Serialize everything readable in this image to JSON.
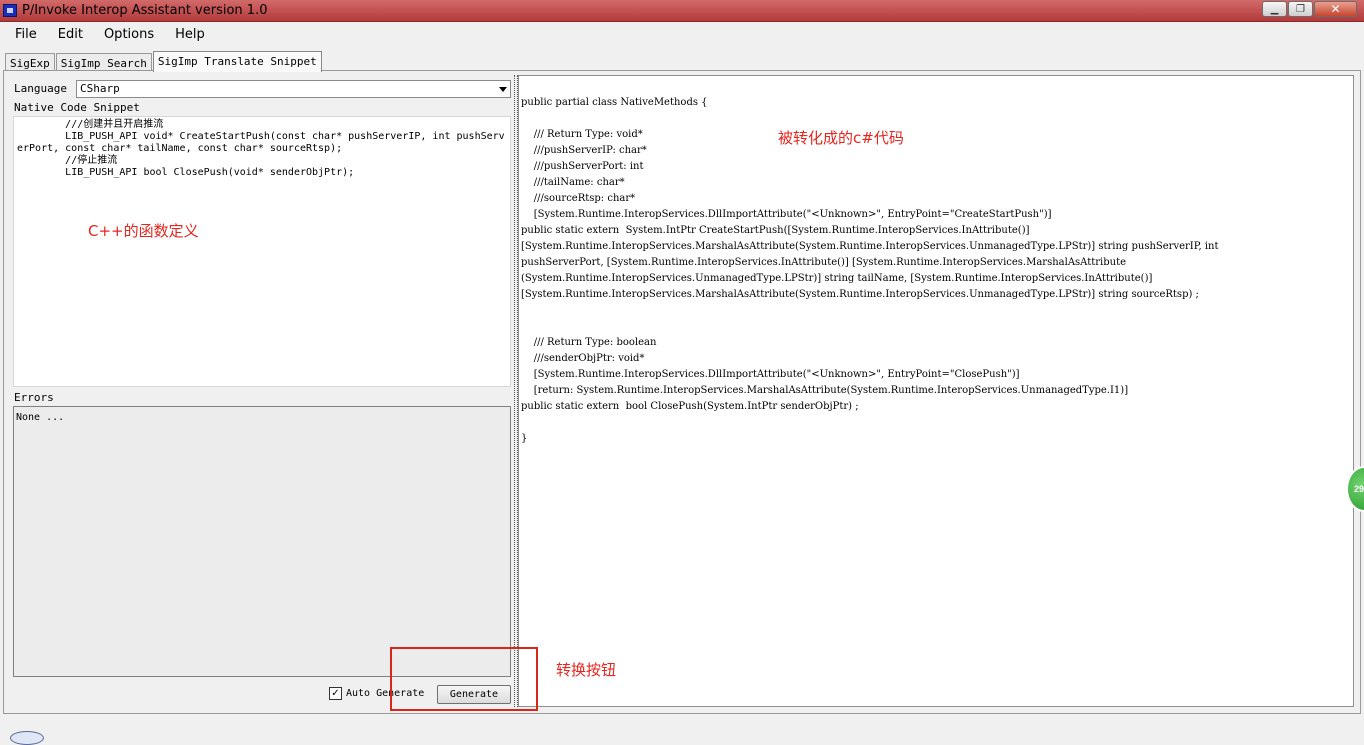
{
  "window": {
    "title": "P/Invoke Interop Assistant version 1.0",
    "min_glyph": "▁",
    "max_glyph": "❐",
    "close_glyph": "✕"
  },
  "menu": [
    "File",
    "Edit",
    "Options",
    "Help"
  ],
  "tabs": [
    "SigExp",
    "SigImp Search",
    "SigImp Translate Snippet"
  ],
  "active_tab": 2,
  "left": {
    "language_label": "Language",
    "language_value": "CSharp",
    "native_label": "Native Code Snippet",
    "native_code": "        ///创建并且开启推流\n        LIB_PUSH_API void* CreateStartPush(const char* pushServerIP, int pushServerPort, const char* tailName, const char* sourceRtsp);\n        //停止推流\n        LIB_PUSH_API bool ClosePush(void* senderObjPtr);",
    "errors_label": "Errors",
    "errors_text": "None ...",
    "auto_generate_label": "Auto Generate",
    "auto_generate_checked": "✓",
    "generate_label": "Generate"
  },
  "right": {
    "code": "public partial class NativeMethods {\n\n    /// Return Type: void*\n    ///pushServerIP: char*\n    ///pushServerPort: int\n    ///tailName: char*\n    ///sourceRtsp: char*\n    [System.Runtime.InteropServices.DllImportAttribute(\"<Unknown>\", EntryPoint=\"CreateStartPush\")]\npublic static extern  System.IntPtr CreateStartPush([System.Runtime.InteropServices.InAttribute()]\n[System.Runtime.InteropServices.MarshalAsAttribute(System.Runtime.InteropServices.UnmanagedType.LPStr)] string pushServerIP, int\npushServerPort, [System.Runtime.InteropServices.InAttribute()] [System.Runtime.InteropServices.MarshalAsAttribute\n(System.Runtime.InteropServices.UnmanagedType.LPStr)] string tailName, [System.Runtime.InteropServices.InAttribute()]\n[System.Runtime.InteropServices.MarshalAsAttribute(System.Runtime.InteropServices.UnmanagedType.LPStr)] string sourceRtsp) ;\n\n\n    /// Return Type: boolean\n    ///senderObjPtr: void*\n    [System.Runtime.InteropServices.DllImportAttribute(\"<Unknown>\", EntryPoint=\"ClosePush\")]\n    [return: System.Runtime.InteropServices.MarshalAsAttribute(System.Runtime.InteropServices.UnmanagedType.I1)]\npublic static extern  bool ClosePush(System.IntPtr senderObjPtr) ;\n\n}"
  },
  "annotations": {
    "csharp": "被转化成的c#代码",
    "cpp": "C++的函数定义",
    "button": "转换按钮"
  },
  "side_bubble": "29",
  "colors": {
    "annotation": "#e5251e",
    "titlebar": "#c04a4a"
  }
}
